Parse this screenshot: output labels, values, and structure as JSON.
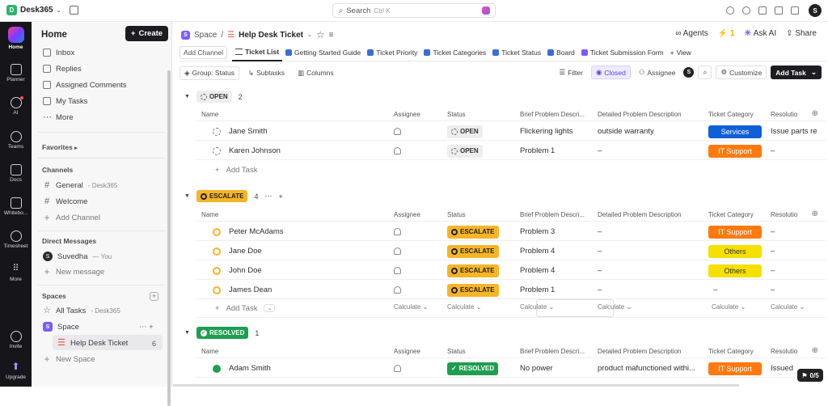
{
  "topbar": {
    "workspace_initial": "D",
    "workspace": "Desk365",
    "search_label": "Search",
    "search_hint": "Ctrl K",
    "user_initial": "S"
  },
  "rail": {
    "items": [
      {
        "label": "Home"
      },
      {
        "label": "Planner"
      },
      {
        "label": "AI"
      },
      {
        "label": "Teams"
      },
      {
        "label": "Docs"
      },
      {
        "label": "Whitebo..."
      },
      {
        "label": "Timesheet"
      },
      {
        "label": "More"
      },
      {
        "label": "Invite"
      },
      {
        "label": "Upgrade"
      }
    ]
  },
  "sidebar": {
    "title": "Home",
    "create_label": "Create",
    "nav": [
      {
        "label": "Inbox"
      },
      {
        "label": "Replies"
      },
      {
        "label": "Assigned Comments"
      },
      {
        "label": "My Tasks"
      },
      {
        "label": "More"
      }
    ],
    "favorites_label": "Favorites",
    "channels_label": "Channels",
    "channels": [
      {
        "label": "General",
        "suffix": "- Desk365"
      },
      {
        "label": "Welcome"
      },
      {
        "label": "Add Channel"
      }
    ],
    "dm_label": "Direct Messages",
    "dm_user": "Suvedha",
    "dm_you": "— You",
    "dm_new": "New message",
    "spaces_label": "Spaces",
    "all_tasks": "All Tasks",
    "all_tasks_suffix": "- Desk365",
    "space_initial": "S",
    "space": "Space",
    "list_item": "Help Desk Ticket",
    "list_count": "6",
    "new_space": "New Space"
  },
  "header": {
    "crumb_space": "Space",
    "crumb_list": "Help Desk Ticket",
    "agents": "Agents",
    "bolt_count": "1",
    "ask_ai": "Ask AI",
    "share": "Share"
  },
  "tabs": [
    {
      "label": "Add Channel"
    },
    {
      "label": "Ticket List"
    },
    {
      "label": "Getting Started Guide"
    },
    {
      "label": "Ticket Priority"
    },
    {
      "label": "Ticket Categories"
    },
    {
      "label": "Ticket Status"
    },
    {
      "label": "Board"
    },
    {
      "label": "Ticket Submission Form"
    },
    {
      "label": "View"
    }
  ],
  "toolbar": {
    "group": "Group: Status",
    "subtasks": "Subtasks",
    "columns": "Columns",
    "filter": "Filter",
    "closed": "Closed",
    "assignee": "Assignee",
    "avatar": "S",
    "customize": "Customize",
    "add_task": "Add Task"
  },
  "columns": {
    "name": "Name",
    "assignee": "Assignee",
    "status": "Status",
    "brief": "Brief Problem Descri...",
    "detailed": "Detailed Problem Description",
    "category": "Ticket Category",
    "resolution": "Resolutio"
  },
  "groups": {
    "open": {
      "label": "OPEN",
      "count": "2",
      "rows": [
        {
          "name": "Jane Smith",
          "status": "OPEN",
          "brief": "Flickering lights",
          "detailed": "outside warranty",
          "category": "Services",
          "resolution": "Issue parts re"
        },
        {
          "name": "Karen Johnson",
          "status": "OPEN",
          "brief": "Problem 1",
          "detailed": "–",
          "category": "IT Support",
          "resolution": "–"
        }
      ],
      "add_task": "Add Task"
    },
    "escalate": {
      "label": "ESCALATE",
      "count": "4",
      "rows": [
        {
          "name": "Peter McAdams",
          "status": "ESCALATE",
          "brief": "Problem 3",
          "detailed": "–",
          "category": "IT Support",
          "resolution": "–"
        },
        {
          "name": "Jane Doe",
          "status": "ESCALATE",
          "brief": "Problem 4",
          "detailed": "–",
          "category": "Others",
          "resolution": "–"
        },
        {
          "name": "John Doe",
          "status": "ESCALATE",
          "brief": "Problem 4",
          "detailed": "–",
          "category": "Others",
          "resolution": "–"
        },
        {
          "name": "James Dean",
          "status": "ESCALATE",
          "brief": "Problem 1",
          "detailed": "–",
          "category": "–",
          "resolution": "–"
        }
      ],
      "add_task": "Add Task",
      "calculate": "Calculate"
    },
    "resolved": {
      "label": "RESOLVED",
      "count": "1",
      "rows": [
        {
          "name": "Adam Smith",
          "status": "RESOLVED",
          "brief": "No power",
          "detailed": "product mafunctioned withi...",
          "category": "IT Support",
          "resolution": "Issued"
        }
      ]
    }
  },
  "badge": "0/5",
  "colors": {
    "escalate": "#f6b526",
    "resolved": "#1e9e50",
    "services": "#0f5fd9",
    "it_support": "#ff7a0e",
    "others": "#f5e000"
  }
}
